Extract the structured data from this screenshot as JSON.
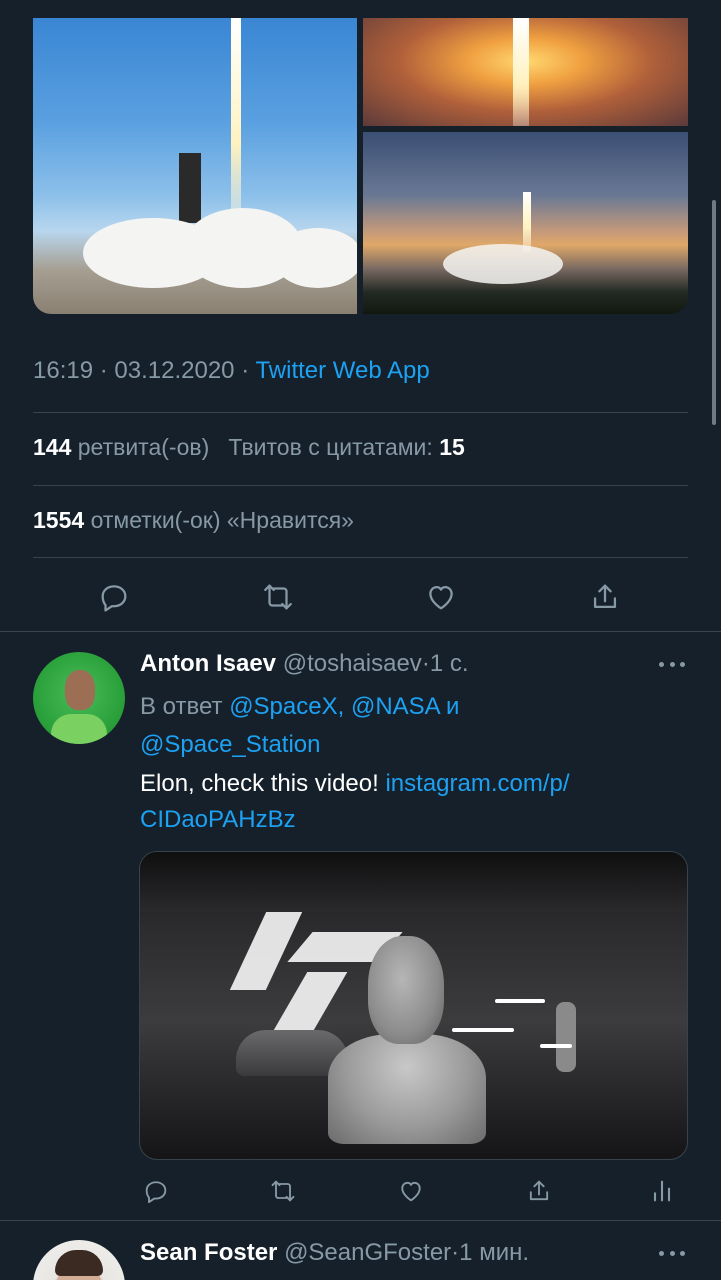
{
  "main_tweet": {
    "time": "16:19",
    "separator": "·",
    "date": "03.12.2020",
    "source": "Twitter Web App",
    "retweets_count": "144",
    "retweets_label": "ретвита(-ов)",
    "quotes_label": "Твитов с цитатами:",
    "quotes_count": "15",
    "likes_count": "1554",
    "likes_label": "отметки(-ок) «Нравится»",
    "actions": [
      "reply-icon",
      "retweet-icon",
      "like-icon",
      "share-icon"
    ]
  },
  "replies": [
    {
      "name": "Anton Isaev",
      "handle": "@toshaisaev",
      "dot": "·",
      "age": "1 с.",
      "reply_prefix": "В ответ",
      "mention_1": "@SpaceX,",
      "mention_2": "@NASA",
      "conjunction": "и",
      "mention_3": "@Space_Station",
      "text": "Elon, check this video!",
      "link_1": "instagram.com/p/",
      "link_2": "CIDaoPAHzBz",
      "actions": [
        "reply-icon",
        "retweet-icon",
        "like-icon",
        "share-icon",
        "analytics-icon"
      ]
    },
    {
      "name": "Sean Foster",
      "handle": "@SeanGFoster",
      "dot": "·",
      "age": "1 мин."
    }
  ],
  "colors": {
    "background": "#15202b",
    "accent": "#1da1f2",
    "secondary_text": "#8899a6",
    "divider": "#38444d"
  }
}
